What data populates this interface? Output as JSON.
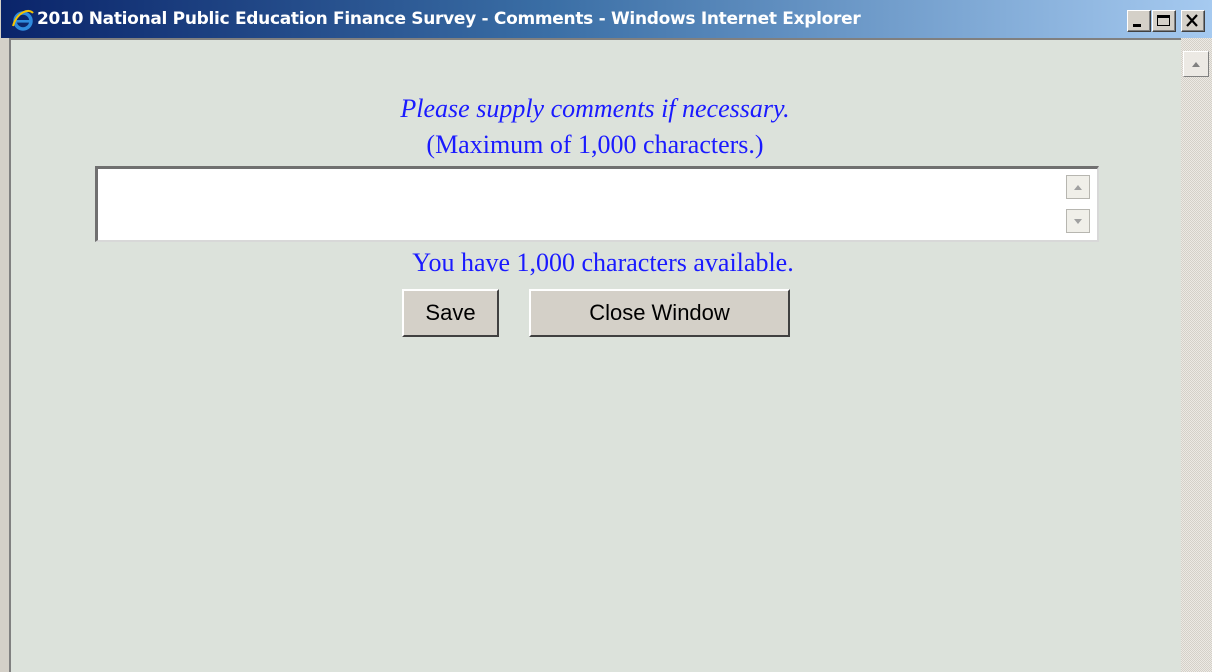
{
  "window": {
    "title": "2010 National Public Education Finance Survey - Comments - Windows Internet Explorer"
  },
  "form": {
    "instruction": "Please supply comments if necessary.",
    "limit_note": "(Maximum of 1,000 characters.)",
    "comments_value": "",
    "chars_available": "You have 1,000 characters available.",
    "save_label": "Save",
    "close_label": "Close Window"
  },
  "icons": {
    "app_icon": "internet-explorer-icon",
    "minimize": "minimize-icon",
    "maximize": "maximize-icon",
    "close": "close-icon",
    "scroll_up": "arrow-up-icon",
    "scroll_down": "arrow-down-icon"
  },
  "colors": {
    "text_blue": "#1a1aff",
    "page_background": "#dce2db",
    "titlebar_start": "#0a246a"
  }
}
